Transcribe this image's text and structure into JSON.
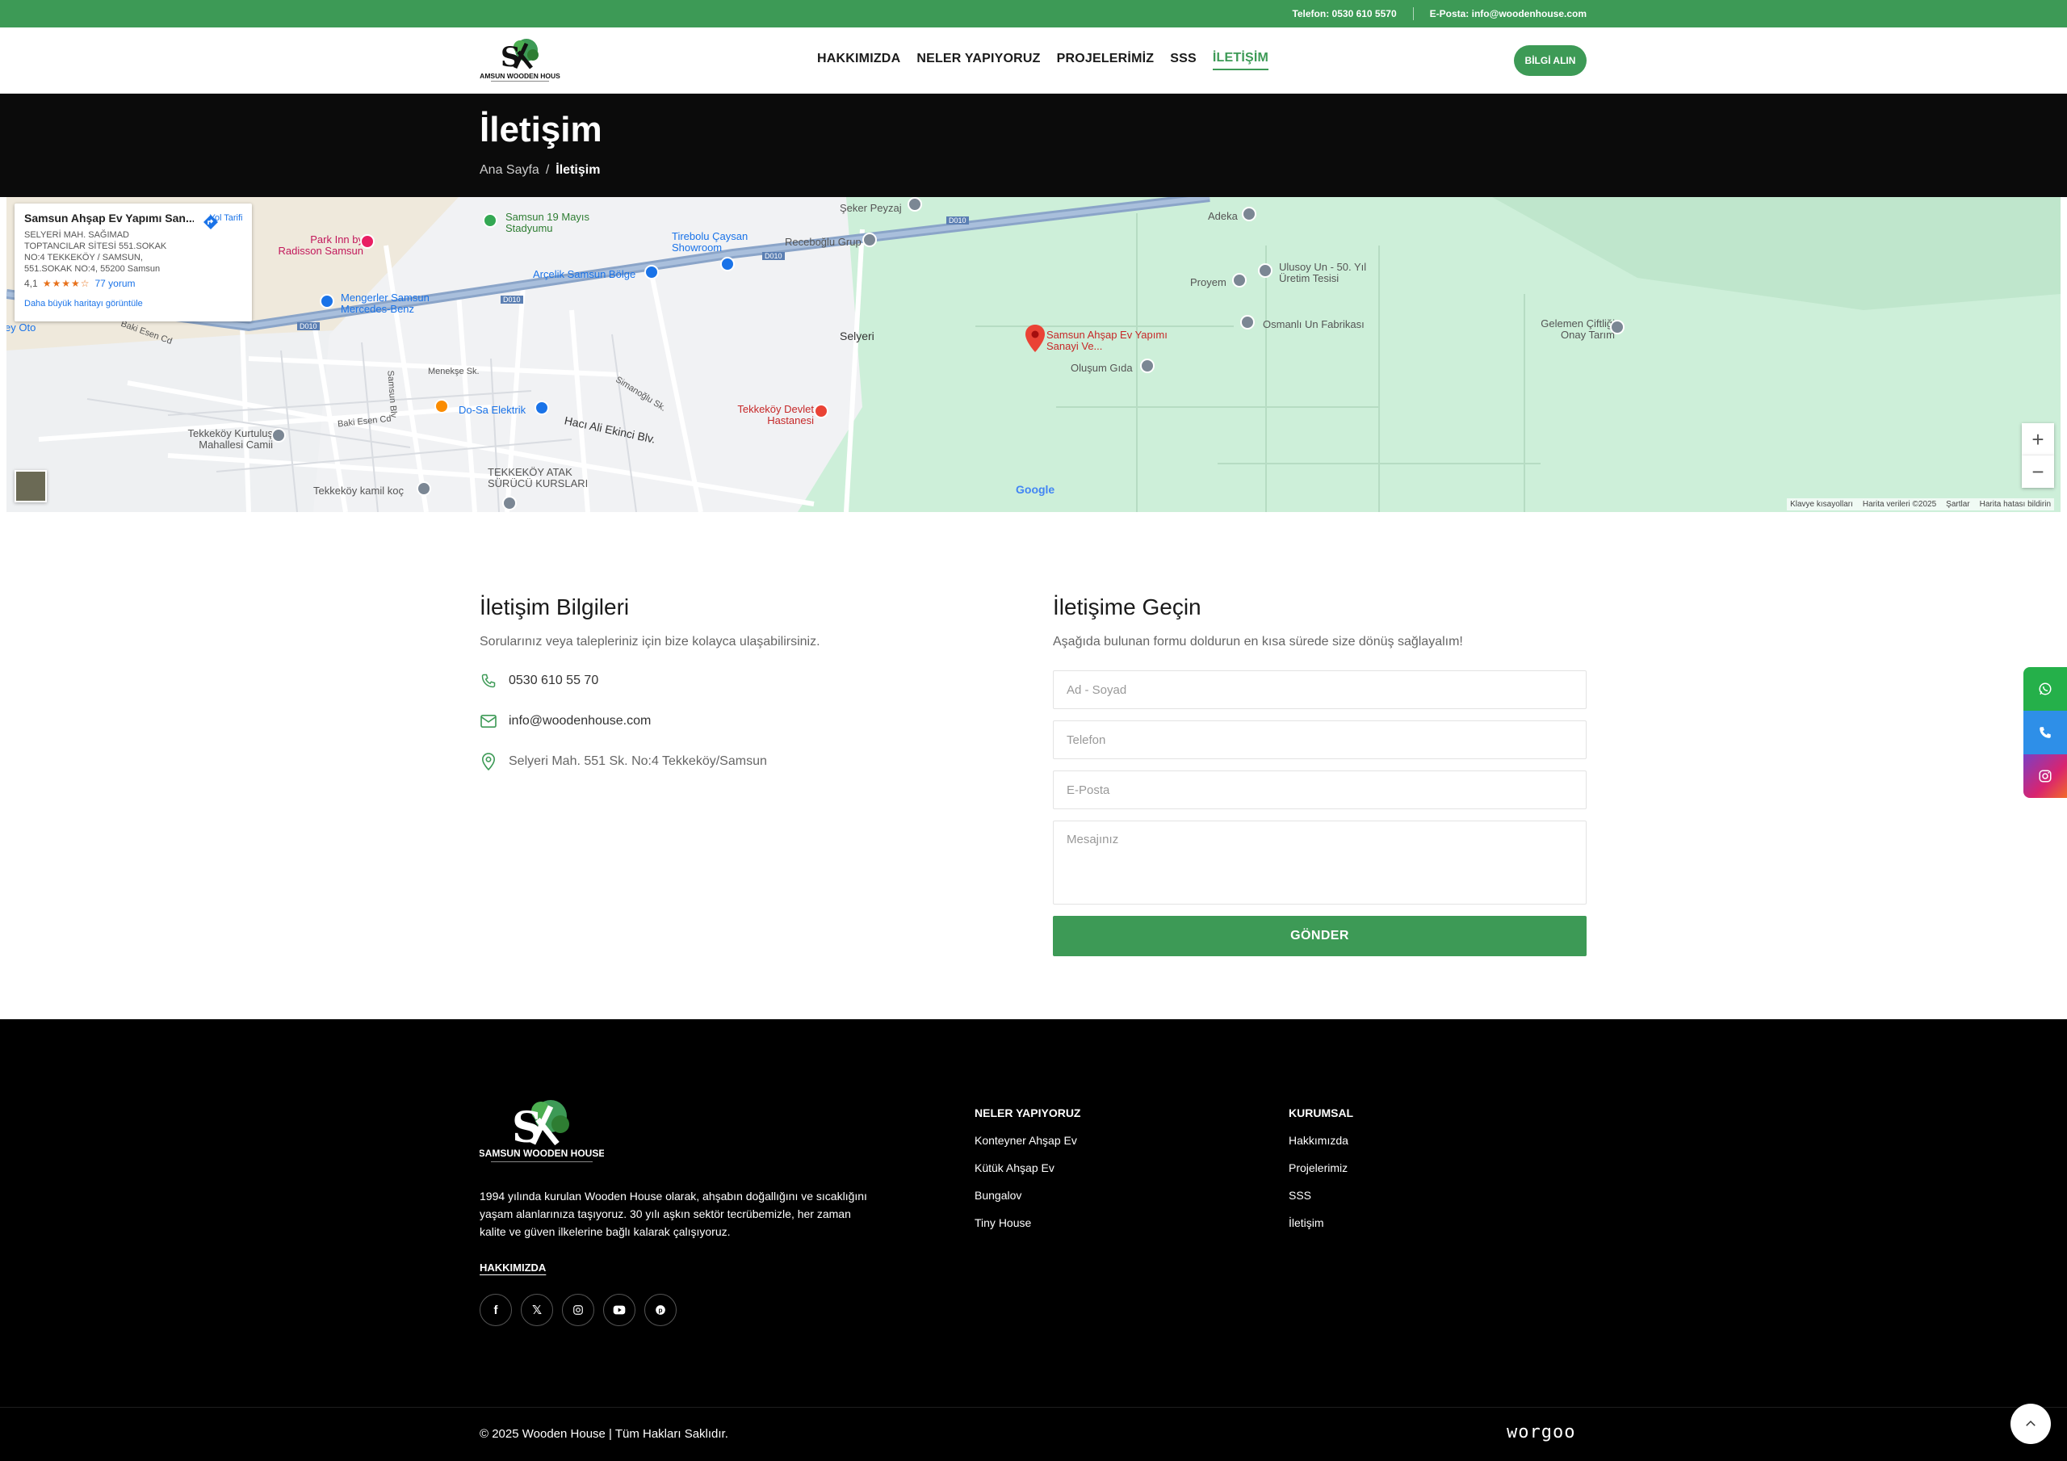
{
  "topbar": {
    "phone": "Telefon: 0530 610 5570",
    "email": "E-Posta: info@woodenhouse.com"
  },
  "header": {
    "logo_text": "SAMSUN WOODEN HOUSE",
    "nav": [
      "HAKKIMIZDA",
      "NELER YAPIYORUZ",
      "PROJELERİMİZ",
      "SSS",
      "İLETİŞİM"
    ],
    "active_nav": "İLETİŞİM",
    "cta": "BİLGİ ALIN"
  },
  "hero": {
    "title": "İletişim",
    "breadcrumb_home": "Ana Sayfa",
    "breadcrumb_sep": "/",
    "breadcrumb_current": "İletişim"
  },
  "map": {
    "info_title": "Samsun Ahşap Ev Yapımı San...",
    "info_address": "SELYERİ MAH. SAĞIMAD TOPTANCILAR SİTESİ 551.SOKAK NO:4 TEKKEKÖY / SAMSUN, 551.SOKAK NO:4, 55200 Samsun",
    "rating": "4,1",
    "stars": "★★★★☆",
    "reviews": "77 yorum",
    "bigger_map": "Daha büyük haritayı görüntüle",
    "directions": "Yol Tarifi",
    "google": "Google",
    "footer_links": [
      "Klavye kısayolları",
      "Harita verileri ©2025",
      "Şartlar",
      "Harita hatası bildirin"
    ],
    "labels": {
      "stadium": "Samsun 19 Mayıs Stadyumu",
      "parkinn": "Park Inn by Radisson Samsun",
      "tirebolu": "Tirebolu Çaysan Showroom",
      "arcelik": "Arçelik Samsun Bölge",
      "mengerler": "Mengerler Samsun Mercedes-Benz",
      "receboglu": "Receboğlu Grup",
      "seker": "Şeker Peyzaj",
      "adeka": "Adeka",
      "proyem": "Proyem",
      "ulusoy": "Ulusoy Un - 50. Yıl Üretim Tesisi",
      "osmanli": "Osmanlı Un Fabrikası",
      "gelemen": "Gelemen Çiftliği Onay Tarım",
      "selyeri": "Selyeri",
      "target": "Samsun Ahşap Ev Yapımı Sanayi Ve...",
      "olusum": "Oluşum Gıda",
      "tekkekoy_hast": "Tekkeköy Devlet Hastanesi",
      "dosa": "Do-Sa Elektrik",
      "kurtulus": "Tekkeköy Kurtuluş Mahallesi Camii",
      "atak": "TEKKEKÖY ATAK SÜRÜCÜ KURSLARI",
      "kamil": "Tekkeköy kamil koç",
      "haci": "Hacı Ali Ekinci Blv.",
      "menekse": "Menekşe Sk.",
      "baki1": "Baki Esen Cd",
      "baki2": "Baki Esen Cd",
      "samsunblv": "Samsun Blv",
      "simanoglu": "Simanoğlu Sk.",
      "oto": "ey Oto",
      "road1": "D010",
      "road2": "D010",
      "road3": "D010",
      "road4": "D010"
    }
  },
  "contact_info": {
    "title": "İletişim Bilgileri",
    "subtitle": "Sorularınız veya talepleriniz için bize kolayca ulaşabilirsiniz.",
    "phone": "0530 610 55 70",
    "email": "info@woodenhouse.com",
    "address": "Selyeri Mah. 551 Sk. No:4 Tekkeköy/Samsun"
  },
  "form": {
    "title": "İletişime Geçin",
    "subtitle": "Aşağıda bulunan formu doldurun en kısa sürede size dönüş sağlayalım!",
    "name_placeholder": "Ad - Soyad",
    "phone_placeholder": "Telefon",
    "email_placeholder": "E-Posta",
    "message_placeholder": "Mesajınız",
    "submit": "GÖNDER"
  },
  "footer": {
    "logo_text": "SAMSUN WOODEN HOUSE",
    "about": "1994 yılında kurulan Wooden House olarak, ahşabın doğallığını ve sıcaklığını yaşam alanlarınıza taşıyoruz. 30 yılı aşkın sektör tecrübemizle, her zaman kalite ve güven ilkelerine bağlı kalarak çalışıyoruz.",
    "about_link": "HAKKIMIZDA",
    "col1_title": "NELER YAPIYORUZ",
    "col1_links": [
      "Konteyner Ahşap Ev",
      "Kütük Ahşap Ev",
      "Bungalov",
      "Tiny House"
    ],
    "col2_title": "KURUMSAL",
    "col2_links": [
      "Hakkımızda",
      "Projelerimiz",
      "SSS",
      "İletişim"
    ],
    "copyright": "© 2025 Wooden House | Tüm Hakları Saklıdır.",
    "brand": "worgoo"
  },
  "colors": {
    "accent": "#3d9a56",
    "dark": "#0b0b0b"
  }
}
